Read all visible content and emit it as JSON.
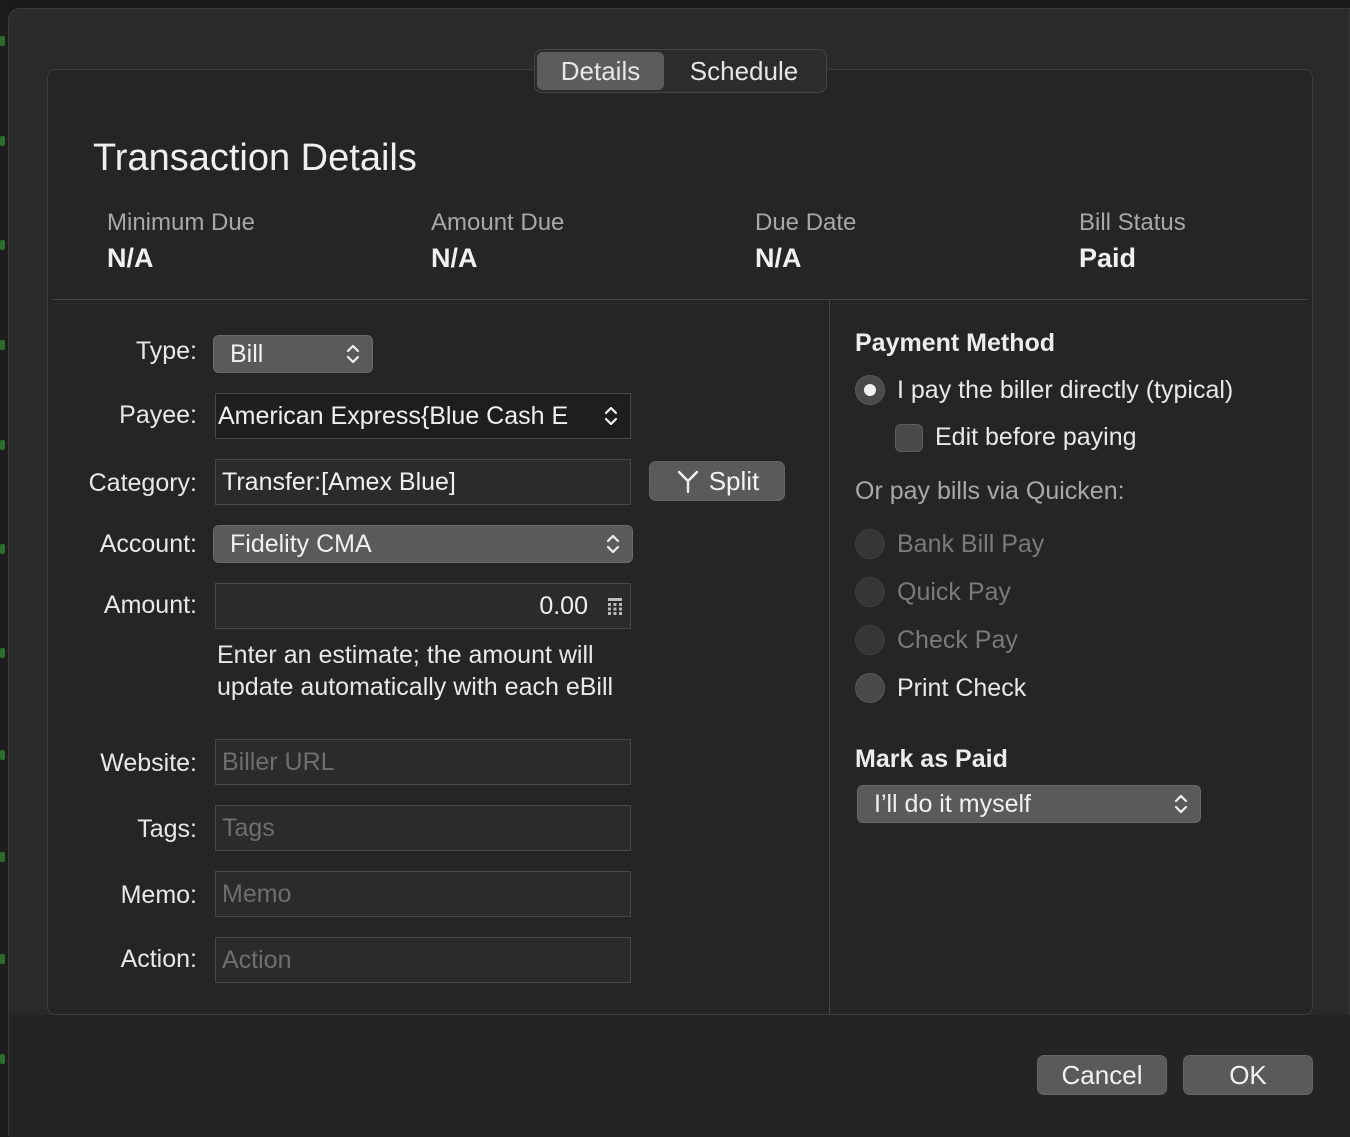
{
  "tabs": [
    {
      "label": "Details",
      "active": true
    },
    {
      "label": "Schedule",
      "active": false
    }
  ],
  "title": "Transaction Details",
  "summary": [
    {
      "label": "Minimum Due",
      "value": "N/A"
    },
    {
      "label": "Amount Due",
      "value": "N/A"
    },
    {
      "label": "Due Date",
      "value": "N/A"
    },
    {
      "label": "Bill Status",
      "value": "Paid"
    }
  ],
  "form": {
    "type_label": "Type:",
    "type_value": "Bill",
    "payee_label": "Payee:",
    "payee_value": "American Express{Blue Cash E",
    "category_label": "Category:",
    "category_value": "Transfer:[Amex Blue]",
    "split_label": "Split",
    "account_label": "Account:",
    "account_value": "Fidelity CMA",
    "amount_label": "Amount:",
    "amount_value": "0.00",
    "hint_line1": "Enter an estimate; the amount will",
    "hint_line2": "update automatically with each eBill",
    "website_label": "Website:",
    "website_placeholder": "Biller URL",
    "tags_label": "Tags:",
    "tags_placeholder": "Tags",
    "memo_label": "Memo:",
    "memo_placeholder": "Memo",
    "action_label": "Action:",
    "action_placeholder": "Action"
  },
  "payment": {
    "title": "Payment Method",
    "direct_label": "I pay the biller directly (typical)",
    "edit_label": "Edit before paying",
    "via_label": "Or pay bills via Quicken:",
    "options": [
      {
        "label": "Bank Bill Pay",
        "enabled": false
      },
      {
        "label": "Quick Pay",
        "enabled": false
      },
      {
        "label": "Check Pay",
        "enabled": false
      },
      {
        "label": "Print Check",
        "enabled": true
      }
    ],
    "mark_title": "Mark as Paid",
    "mark_value": "I’ll do it myself"
  },
  "footer": {
    "cancel_label": "Cancel",
    "ok_label": "OK"
  }
}
